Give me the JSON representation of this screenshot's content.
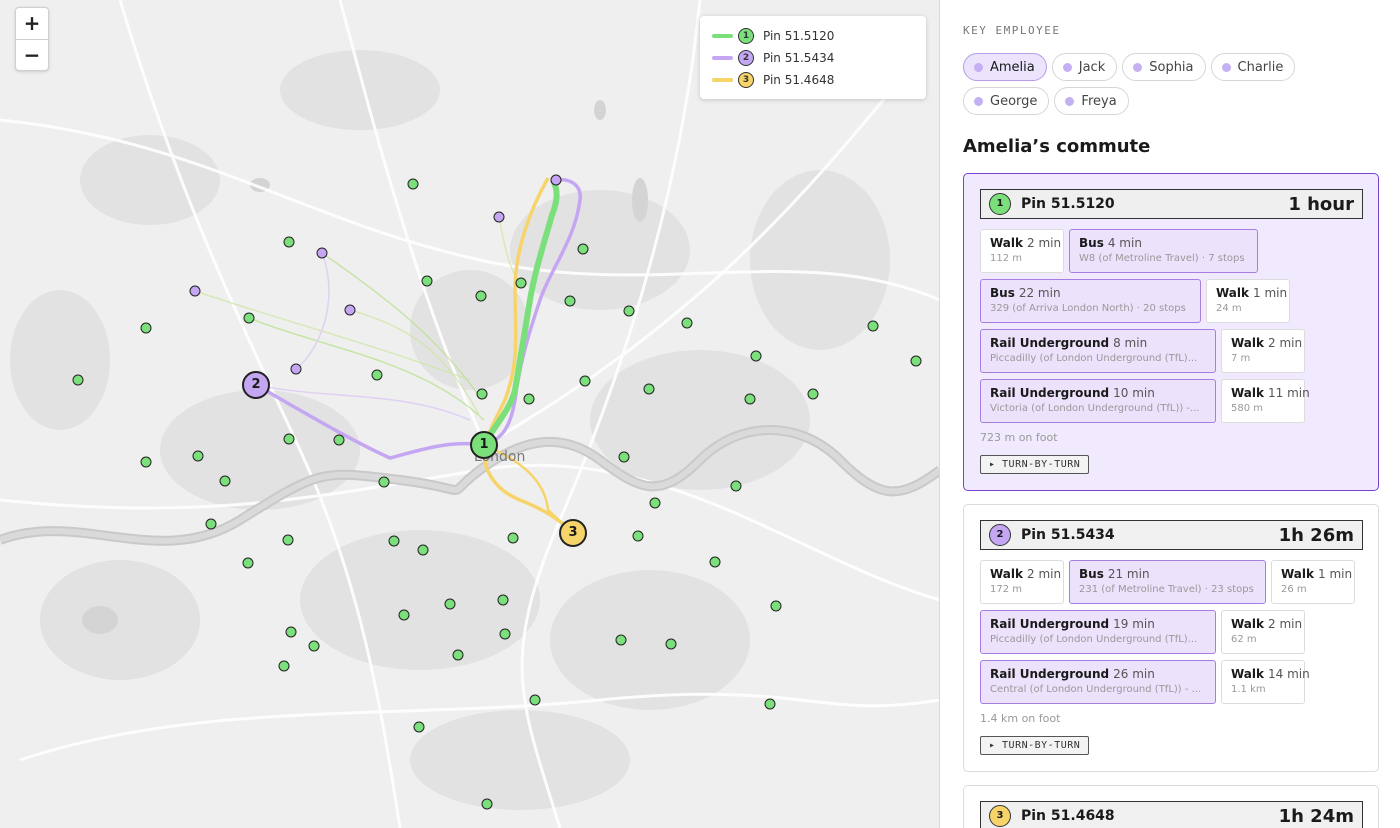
{
  "map": {
    "zoom_in_label": "+",
    "zoom_out_label": "−",
    "city_label": "London",
    "legend": [
      {
        "num": "1",
        "label": "Pin 51.5120",
        "color": "#7be07b"
      },
      {
        "num": "2",
        "label": "Pin 51.5434",
        "color": "#c4a6f3"
      },
      {
        "num": "3",
        "label": "Pin 51.4648",
        "color": "#f6d469"
      }
    ],
    "pins": [
      {
        "num": "1",
        "color": "#7be07b"
      },
      {
        "num": "2",
        "color": "#c4a6f3"
      },
      {
        "num": "3",
        "color": "#f6d469"
      }
    ]
  },
  "panel": {
    "section_label": "KEY EMPLOYEE",
    "employees": [
      "Amelia",
      "Jack",
      "Sophia",
      "Charlie",
      "George",
      "Freya"
    ],
    "selected_employee": "Amelia",
    "commute_title": "Amelia’s commute",
    "cards": [
      {
        "num": "1",
        "badge_color": "#7be07b",
        "pin": "Pin 51.5120",
        "duration": "1 hour",
        "rows": [
          [
            {
              "mode": "Walk",
              "time": "2 min",
              "detail": "112 m",
              "transit": false
            },
            {
              "mode": "Bus",
              "time": "4 min",
              "detail": "W8 (of Metroline Travel) · 7 stops",
              "transit": true
            }
          ],
          [
            {
              "mode": "Bus",
              "time": "22 min",
              "detail": "329 (of Arriva London North) · 20 stops",
              "transit": true
            },
            {
              "mode": "Walk",
              "time": "1 min",
              "detail": "24 m",
              "transit": false
            }
          ],
          [
            {
              "mode": "Rail Underground",
              "time": "8 min",
              "detail": "Piccadilly (of London Underground (TfL)...",
              "transit": true
            },
            {
              "mode": "Walk",
              "time": "2 min",
              "detail": "7 m",
              "transit": false
            }
          ],
          [
            {
              "mode": "Rail Underground",
              "time": "10 min",
              "detail": "Victoria (of London Underground (TfL)) -...",
              "transit": true
            },
            {
              "mode": "Walk",
              "time": "11 min",
              "detail": "580 m",
              "transit": false
            }
          ]
        ],
        "foot": "723 m on foot",
        "tbt": "▸ TURN-BY-TURN"
      },
      {
        "num": "2",
        "badge_color": "#c4a6f3",
        "pin": "Pin 51.5434",
        "duration": "1h 26m",
        "rows": [
          [
            {
              "mode": "Walk",
              "time": "2 min",
              "detail": "172 m",
              "transit": false
            },
            {
              "mode": "Bus",
              "time": "21 min",
              "detail": "231 (of Metroline Travel) · 23 stops",
              "transit": true
            },
            {
              "mode": "Walk",
              "time": "1 min",
              "detail": "26 m",
              "transit": false
            }
          ],
          [
            {
              "mode": "Rail Underground",
              "time": "19 min",
              "detail": "Piccadilly (of London Underground (TfL)...",
              "transit": true
            },
            {
              "mode": "Walk",
              "time": "2 min",
              "detail": "62 m",
              "transit": false
            }
          ],
          [
            {
              "mode": "Rail Underground",
              "time": "26 min",
              "detail": "Central (of London Underground (TfL)) - ...",
              "transit": true
            },
            {
              "mode": "Walk",
              "time": "14 min",
              "detail": "1.1 km",
              "transit": false
            }
          ]
        ],
        "foot": "1.4 km on foot",
        "tbt": "▸ TURN-BY-TURN"
      },
      {
        "num": "3",
        "badge_color": "#f6d469",
        "pin": "Pin 51.4648",
        "duration": "1h 24m",
        "rows": [],
        "foot": "",
        "tbt": ""
      }
    ]
  }
}
